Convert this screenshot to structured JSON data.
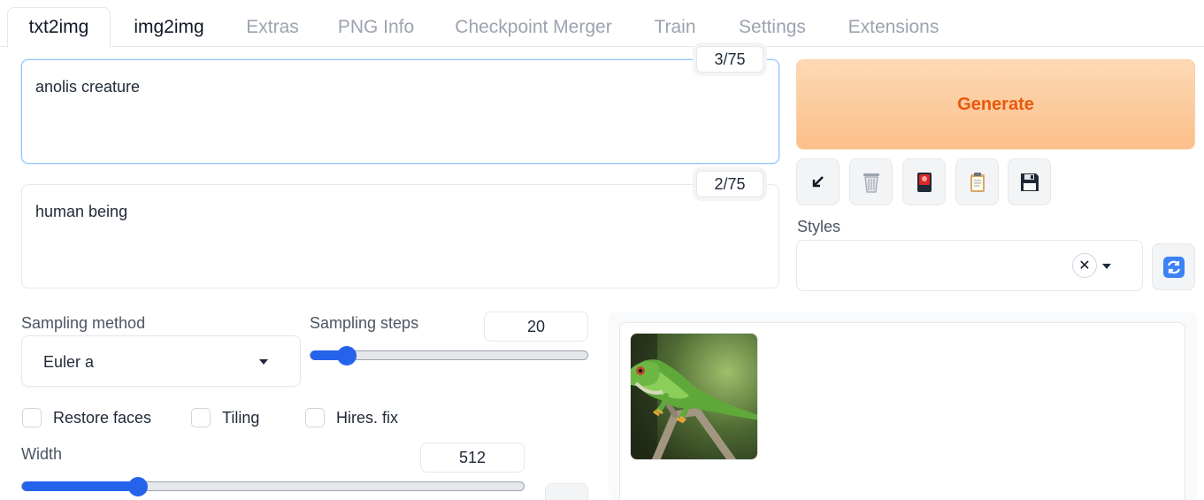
{
  "tabs": [
    {
      "label": "txt2img"
    },
    {
      "label": "img2img"
    },
    {
      "label": "Extras"
    },
    {
      "label": "PNG Info"
    },
    {
      "label": "Checkpoint Merger"
    },
    {
      "label": "Train"
    },
    {
      "label": "Settings"
    },
    {
      "label": "Extensions"
    }
  ],
  "prompt": {
    "value": "anolis creature",
    "token_count": "3/75"
  },
  "negative_prompt": {
    "value": "human being",
    "token_count": "2/75"
  },
  "generate_label": "Generate",
  "tools": [
    "arrow-down-left-icon",
    "trash-icon",
    "red-card-icon",
    "clipboard-icon",
    "floppy-disk-icon"
  ],
  "styles": {
    "label": "Styles",
    "clear_symbol": "✕"
  },
  "sampling": {
    "method_label": "Sampling method",
    "method_value": "Euler a",
    "steps_label": "Sampling steps",
    "steps_value": "20",
    "steps_fraction": 0.13
  },
  "checkboxes": [
    {
      "label": "Restore faces"
    },
    {
      "label": "Tiling"
    },
    {
      "label": "Hires. fix"
    }
  ],
  "width": {
    "label": "Width",
    "value": "512",
    "fraction": 0.23
  },
  "colors": {
    "accent": "#2563eb",
    "generate_text": "#ea580c",
    "generate_bg": "#fbbf8a"
  }
}
